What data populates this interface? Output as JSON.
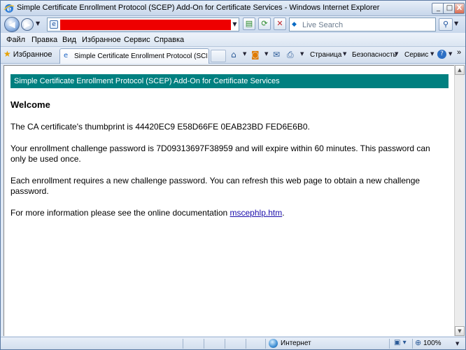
{
  "window": {
    "title": "Simple Certificate Enrollment Protocol (SCEP) Add-On for Certificate Services - Windows Internet Explorer",
    "minimize": "_",
    "maximize": "□",
    "close": "X"
  },
  "address": {
    "search_placeholder": "Live Search"
  },
  "menu": {
    "file": "Файл",
    "edit": "Правка",
    "view": "Вид",
    "favorites": "Избранное",
    "tools": "Сервис",
    "help": "Справка"
  },
  "toolbar": {
    "favorites_center": "Избранное",
    "tab_title": "Simple Certificate Enrollment Protocol (SCEP)...",
    "page": "Страница",
    "safety": "Безопасность",
    "tools": "Сервис",
    "more": "»"
  },
  "page": {
    "banner": "Simple Certificate Enrollment Protocol (SCEP) Add-On for Certificate Services",
    "heading": "Welcome",
    "thumbprint_text": "The CA certificate's thumbprint is 44420EC9 E58D66FE 0EAB23BD FED6E6B0.",
    "password_text": "Your enrollment challenge password is 7D09313697F38959 and will expire within 60 minutes.   This password can only be used once.",
    "refresh_text": "Each enrollment requires a new challenge password.   You can refresh this web page to obtain a new challenge password.",
    "info_text": "For more information please see the online documentation ",
    "doc_link": "mscephlp.htm",
    "info_end": "."
  },
  "status": {
    "zone": "Интернет",
    "zoom": "100%"
  },
  "icons": {
    "back": "arrow-left-icon",
    "forward": "arrow-right-icon",
    "refresh": "refresh-icon",
    "stop": "stop-icon",
    "search": "search-icon",
    "home": "home-icon",
    "feeds": "rss-icon",
    "print": "printer-icon",
    "help": "help-icon"
  },
  "colors": {
    "banner_bg": "#008080",
    "link": "#1a0dab",
    "redacted_address": "#ee0000"
  }
}
